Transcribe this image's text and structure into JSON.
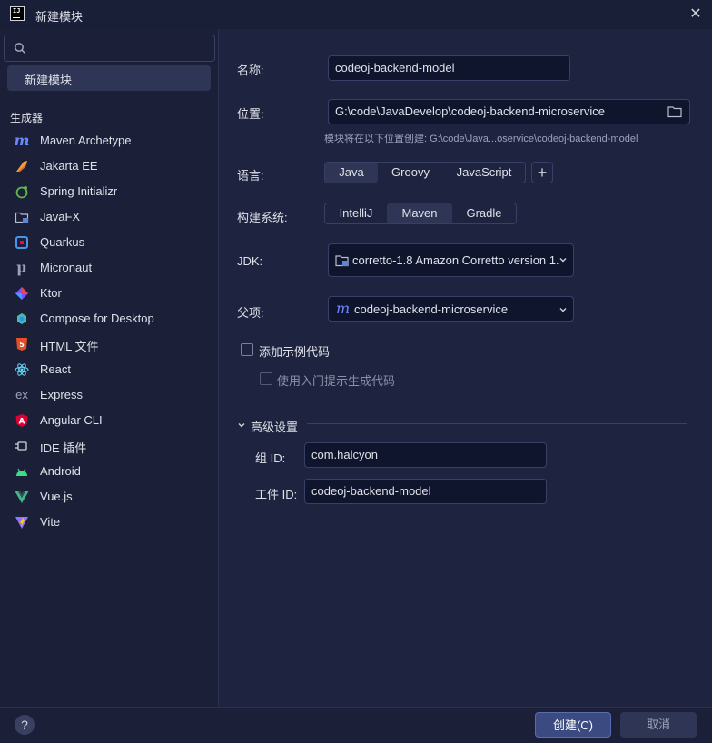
{
  "window": {
    "title": "新建模块",
    "close_glyph": "✕",
    "app_icon_text": "IJ"
  },
  "sidebar": {
    "search_placeholder": "",
    "selected_item": "新建模块",
    "group_label": "生成器",
    "items": [
      {
        "label": "Maven Archetype",
        "icon": "maven-icon"
      },
      {
        "label": "Jakarta EE",
        "icon": "jakarta-ee-icon"
      },
      {
        "label": "Spring Initializr",
        "icon": "spring-icon"
      },
      {
        "label": "JavaFX",
        "icon": "javafx-folder-icon"
      },
      {
        "label": "Quarkus",
        "icon": "quarkus-icon"
      },
      {
        "label": "Micronaut",
        "icon": "micronaut-icon"
      },
      {
        "label": "Ktor",
        "icon": "ktor-icon"
      },
      {
        "label": "Compose for Desktop",
        "icon": "compose-icon"
      },
      {
        "label": "HTML 文件",
        "icon": "html5-icon"
      },
      {
        "label": "React",
        "icon": "react-icon"
      },
      {
        "label": "Express",
        "icon": "express-icon"
      },
      {
        "label": "Angular CLI",
        "icon": "angular-icon"
      },
      {
        "label": "IDE 插件",
        "icon": "plugin-icon"
      },
      {
        "label": "Android",
        "icon": "android-icon"
      },
      {
        "label": "Vue.js",
        "icon": "vue-icon"
      },
      {
        "label": "Vite",
        "icon": "vite-icon"
      }
    ]
  },
  "form": {
    "name_label": "名称:",
    "name_value": "codeoj-backend-model",
    "location_label": "位置:",
    "location_value": "G:\\code\\JavaDevelop\\codeoj-backend-microservice",
    "location_hint": "模块将在以下位置创建: G:\\code\\Java...oservice\\codeoj-backend-model",
    "language_label": "语言:",
    "languages": [
      "Java",
      "Groovy",
      "JavaScript"
    ],
    "language_selected": "Java",
    "add_language_glyph": "+",
    "build_label": "构建系统:",
    "build_systems": [
      "IntelliJ",
      "Maven",
      "Gradle"
    ],
    "build_selected": "Maven",
    "jdk_label": "JDK:",
    "jdk_value": "corretto-1.8 Amazon Corretto version 1.",
    "parent_label": "父项:",
    "parent_value": "codeoj-backend-microservice",
    "parent_icon_glyph": "m",
    "sample_code_label": "添加示例代码",
    "sample_code_checked": false,
    "onboarding_label": "使用入门提示生成代码",
    "onboarding_checked": false,
    "advanced_label": "高级设置",
    "group_id_label": "组 ID:",
    "group_id_value": "com.halcyon",
    "artifact_id_label": "工件 ID:",
    "artifact_id_value": "codeoj-backend-model"
  },
  "footer": {
    "help_glyph": "?",
    "create_label": "创建(C)",
    "cancel_label": "取消"
  },
  "colors": {
    "background": "#1e2440",
    "sidebar": "#1b2038",
    "field": "#10152e",
    "accent": "#3b4b82",
    "selected": "#2e3555"
  }
}
